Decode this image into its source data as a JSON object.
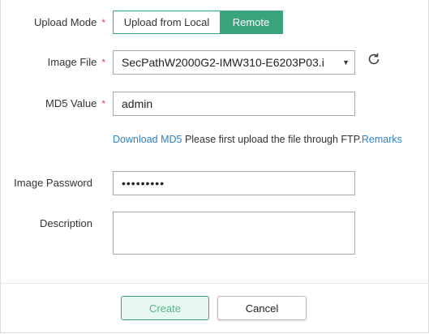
{
  "form": {
    "upload_mode": {
      "label": "Upload Mode",
      "required": "*",
      "options": [
        "Upload from Local",
        "Remote"
      ],
      "selected": "Remote"
    },
    "image_file": {
      "label": "Image File",
      "required": "*",
      "value": "SecPathW2000G2-IMW310-E6203P03.i"
    },
    "md5_value": {
      "label": "MD5 Value",
      "required": "*",
      "value": "admin"
    },
    "md5_note": {
      "download_link": "Download MD5",
      "text": " Please first upload the file through FTP.",
      "remarks_link": "Remarks"
    },
    "image_password": {
      "label": "Image Password",
      "value": "•••••••••"
    },
    "description": {
      "label": "Description",
      "value": ""
    }
  },
  "footer": {
    "create_label": "Create",
    "cancel_label": "Cancel"
  },
  "colors": {
    "accent": "#3aa57d",
    "link": "#2f7fc1",
    "required": "#e64545"
  }
}
